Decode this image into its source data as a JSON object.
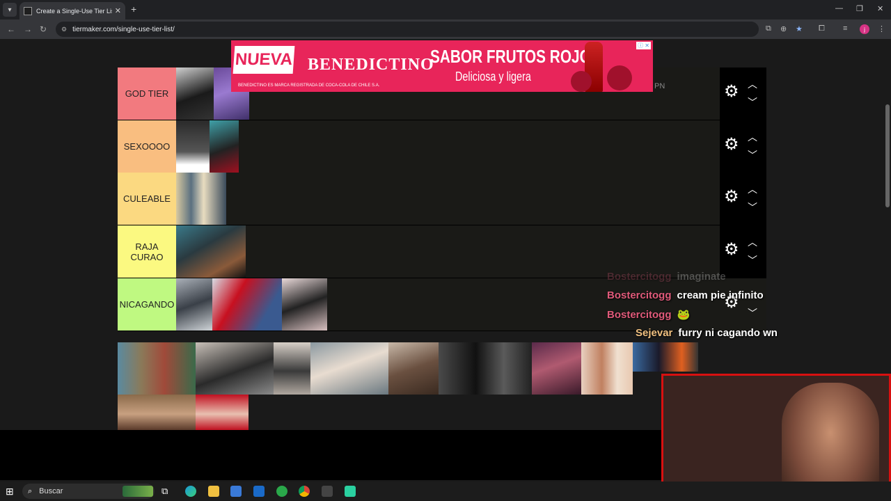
{
  "browser": {
    "tab_title": "Create a Single-Use Tier List (P...",
    "url": "tiermaker.com/single-use-tier-list/",
    "profile_initial": "j"
  },
  "ad": {
    "badge": "NUEVA",
    "brand": "BENEDICTINO",
    "title": "SABOR FRUTOS ROJOS",
    "subtitle": "Deliciosa y ligera",
    "legal": "BENEDICTINO ES MARCA REGISTRADA DE COCA-COLA DE CHILE S.A.",
    "info": "ⓘ ✕"
  },
  "tiers": [
    {
      "label": "GOD TIER",
      "color": "#f27a7f"
    },
    {
      "label": "SEXOOOO",
      "color": "#f9be80"
    },
    {
      "label": "CULEABLE",
      "color": "#fbd981"
    },
    {
      "label": "RAJA CURAO",
      "color": "#fbf981"
    },
    {
      "label": "NICAGANDO",
      "color": "#bff981"
    }
  ],
  "overlay_text": "PN",
  "chat": [
    {
      "user": "Bostercitogg",
      "msg": "imaginate",
      "user_color": "#e05a7a",
      "faded": true
    },
    {
      "user": "Bostercitogg",
      "msg": "cream pie infinito",
      "user_color": "#e05a7a",
      "faded": false
    },
    {
      "user": "Bostercitogg",
      "msg": "🐸",
      "user_color": "#e05a7a",
      "faded": false
    },
    {
      "user": "Sejevar",
      "msg": "furry ni cagando wn",
      "user_color": "#f0c080",
      "faded": false
    }
  ],
  "taskbar": {
    "search_label": "Buscar"
  }
}
